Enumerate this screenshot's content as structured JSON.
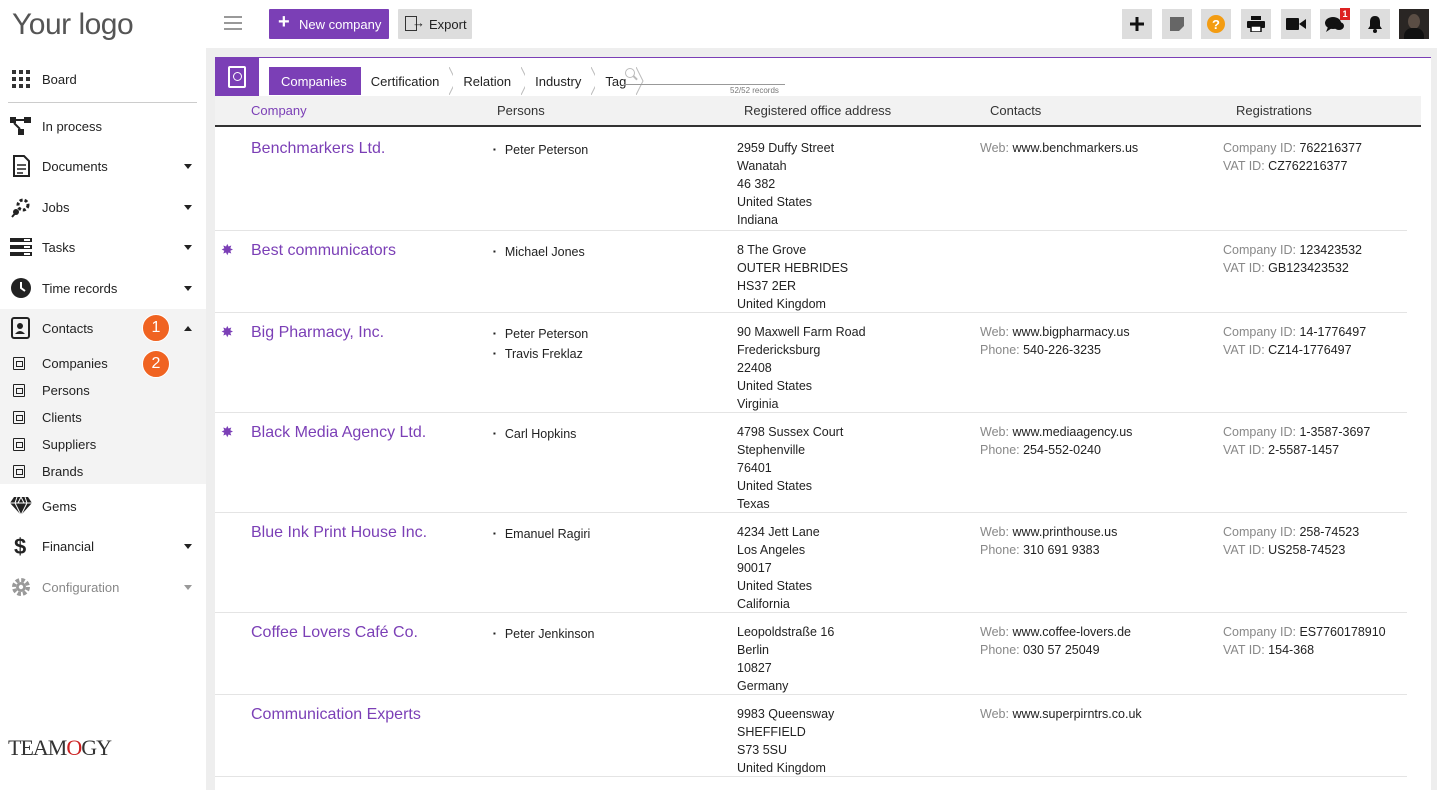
{
  "sidebar": {
    "logo": "Your logo",
    "items": [
      {
        "label": "Board"
      },
      {
        "label": "In process"
      },
      {
        "label": "Documents"
      },
      {
        "label": "Jobs"
      },
      {
        "label": "Tasks"
      },
      {
        "label": "Time records"
      },
      {
        "label": "Contacts"
      },
      {
        "label": "Gems"
      },
      {
        "label": "Financial"
      },
      {
        "label": "Configuration"
      }
    ],
    "sub_items": [
      {
        "label": "Companies"
      },
      {
        "label": "Persons"
      },
      {
        "label": "Clients"
      },
      {
        "label": "Suppliers"
      },
      {
        "label": "Brands"
      }
    ],
    "annotations": [
      "1",
      "2"
    ],
    "footer_logo": {
      "pre": "TEAM",
      "mid": "O",
      "post": "GY"
    }
  },
  "toolbar": {
    "new_label": "New company",
    "export_label": "Export",
    "chat_badge": "1"
  },
  "breadcrumbs": [
    "Companies",
    "Certification",
    "Relation",
    "Industry",
    "Tag"
  ],
  "search": {
    "records": "52/52 records"
  },
  "table": {
    "headers": [
      "Company",
      "Persons",
      "Registered office address",
      "Contacts",
      "Registrations"
    ],
    "labels": {
      "web": "Web:",
      "phone": "Phone:",
      "company_id": "Company ID:",
      "vat_id": "VAT ID:"
    },
    "rows": [
      {
        "name": "Benchmarkers Ltd.",
        "starred": false,
        "persons": [
          "Peter Peterson"
        ],
        "address": [
          "2959 Duffy Street",
          "Wanatah",
          "46 382",
          "United States",
          "Indiana"
        ],
        "web": "www.benchmarkers.us",
        "phone": "",
        "company_id": "762216377",
        "vat_id": "CZ762216377"
      },
      {
        "name": "Best communicators",
        "starred": true,
        "persons": [
          "Michael Jones"
        ],
        "address": [
          "8 The Grove",
          "OUTER HEBRIDES",
          "HS37 2ER",
          "United Kingdom"
        ],
        "web": "",
        "phone": "",
        "company_id": "123423532",
        "vat_id": "GB123423532"
      },
      {
        "name": "Big Pharmacy, Inc.",
        "starred": true,
        "persons": [
          "Peter Peterson",
          "Travis Freklaz"
        ],
        "address": [
          "90 Maxwell Farm Road",
          "Fredericksburg",
          "22408",
          "United States",
          "Virginia"
        ],
        "web": "www.bigpharmacy.us",
        "phone": "540-226-3235",
        "company_id": "14-1776497",
        "vat_id": "CZ14-1776497"
      },
      {
        "name": "Black Media Agency Ltd.",
        "starred": true,
        "persons": [
          "Carl Hopkins"
        ],
        "address": [
          "4798 Sussex Court",
          "Stephenville",
          "76401",
          "United States",
          "Texas"
        ],
        "web": "www.mediaagency.us",
        "phone": "254-552-0240",
        "company_id": "1-3587-3697",
        "vat_id": "2-5587-1457"
      },
      {
        "name": "Blue Ink Print House Inc.",
        "starred": false,
        "persons": [
          "Emanuel Ragiri"
        ],
        "address": [
          "4234 Jett Lane",
          "Los Angeles",
          "90017",
          "United States",
          "California"
        ],
        "web": "www.printhouse.us",
        "phone": "310 691 9383",
        "company_id": "258-74523",
        "vat_id": "US258-74523"
      },
      {
        "name": "Coffee Lovers Café Co.",
        "starred": false,
        "persons": [
          "Peter Jenkinson"
        ],
        "address": [
          "Leopoldstraße 16",
          "Berlin",
          "10827",
          "Germany"
        ],
        "web": "www.coffee-lovers.de",
        "phone": "030 57 25049",
        "company_id": "ES7760178910",
        "vat_id": "154-368"
      },
      {
        "name": "Communication Experts",
        "starred": false,
        "persons": [],
        "address": [
          "9983 Queensway",
          "SHEFFIELD",
          "S73 5SU",
          "United Kingdom"
        ],
        "web": "www.superpirntrs.co.uk",
        "phone": "",
        "company_id": "",
        "vat_id": ""
      }
    ]
  },
  "colors": {
    "accent": "#7b3fb6",
    "badge": "#f06321",
    "notify": "#dd2222"
  },
  "icons": [
    "board-icon",
    "process-icon",
    "document-icon",
    "jobs-icon",
    "tasks-icon",
    "clock-icon",
    "contacts-icon",
    "gem-icon",
    "dollar-icon",
    "gear-icon"
  ]
}
